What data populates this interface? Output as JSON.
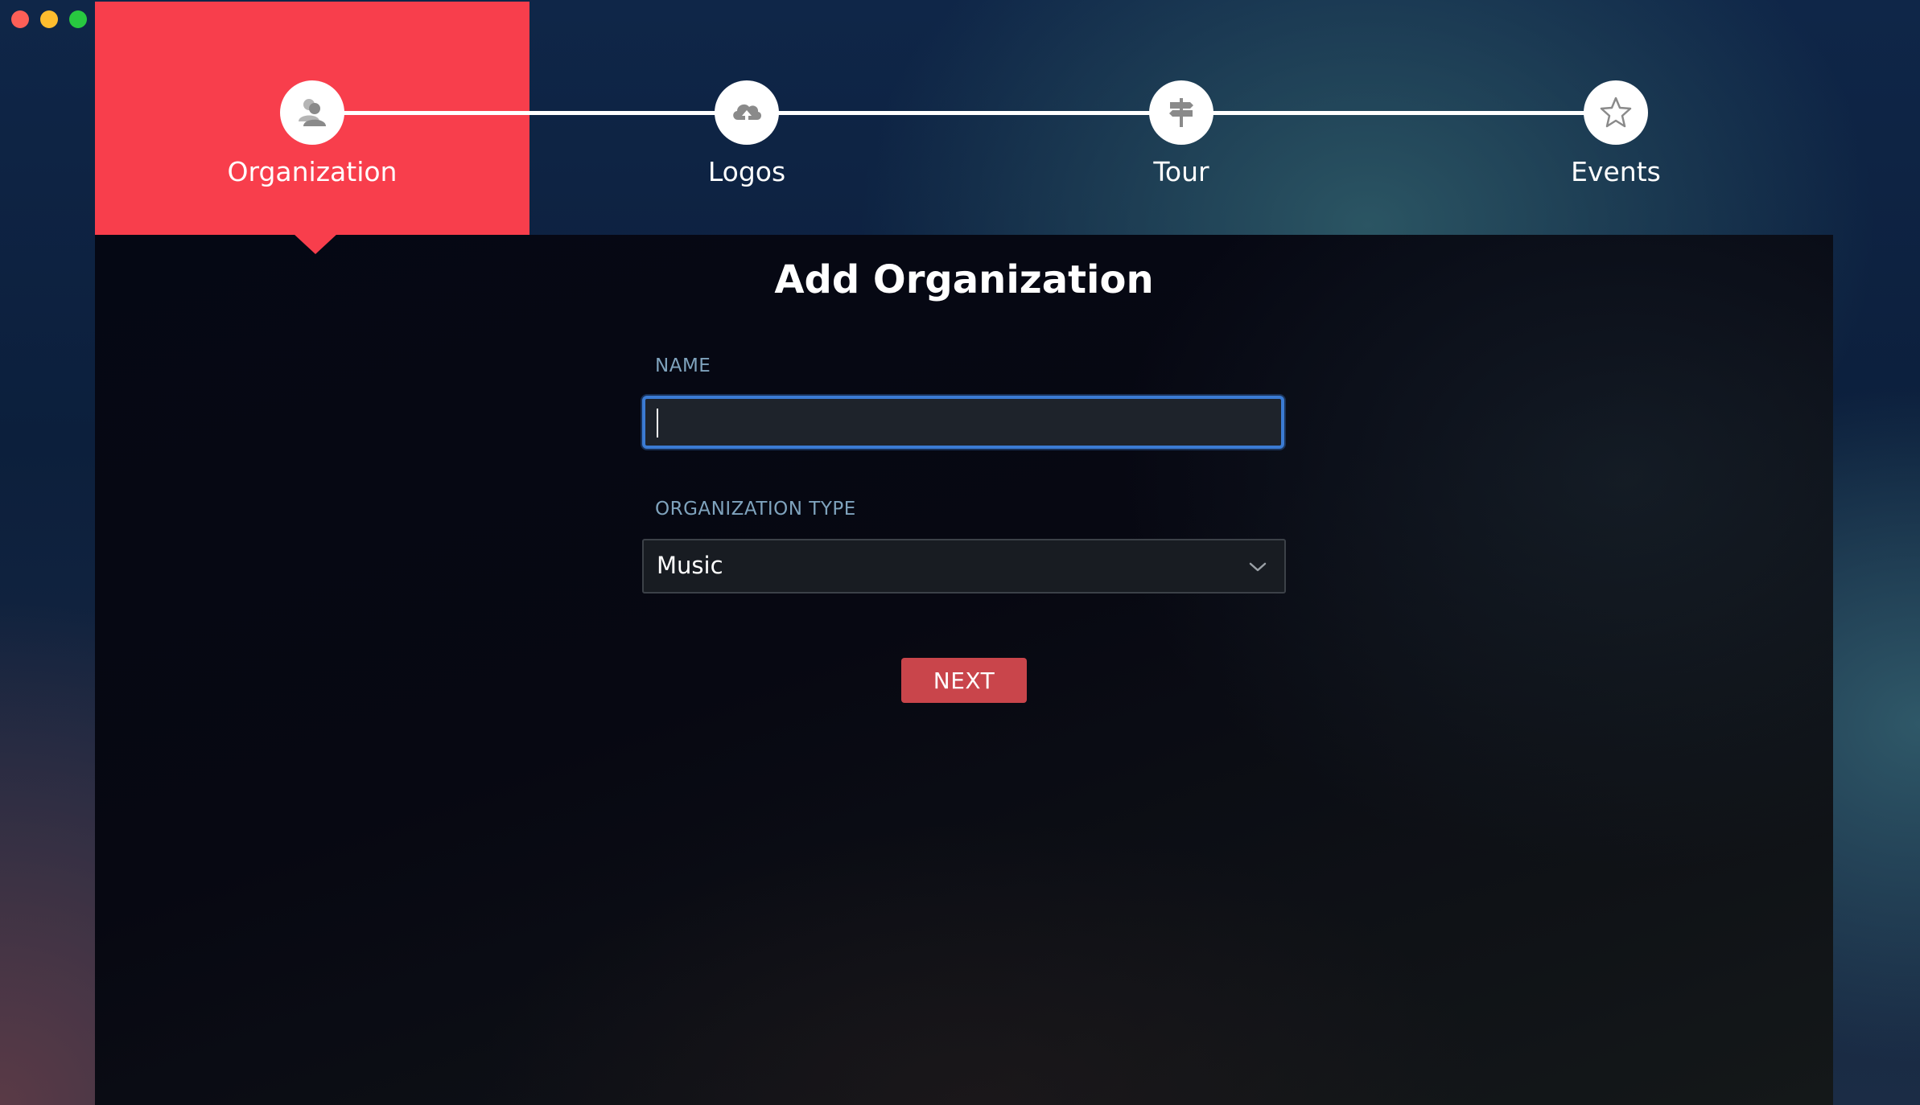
{
  "window": {
    "controls": [
      "close",
      "minimize",
      "zoom"
    ]
  },
  "stepper": {
    "active_index": 0,
    "accent_color": "#f83e4c",
    "steps": [
      {
        "label": "Organization",
        "icon": "user-group-icon"
      },
      {
        "label": "Logos",
        "icon": "cloud-upload-icon"
      },
      {
        "label": "Tour",
        "icon": "signpost-icon"
      },
      {
        "label": "Events",
        "icon": "star-icon"
      }
    ]
  },
  "form": {
    "title": "Add Organization",
    "name_label": "NAME",
    "name_value": "",
    "type_label": "ORGANIZATION TYPE",
    "type_value": "Music",
    "next_label": "NEXT"
  },
  "colors": {
    "focus_border": "#3b7bd3",
    "button": "#c9454b",
    "label": "#7fa3bd"
  }
}
